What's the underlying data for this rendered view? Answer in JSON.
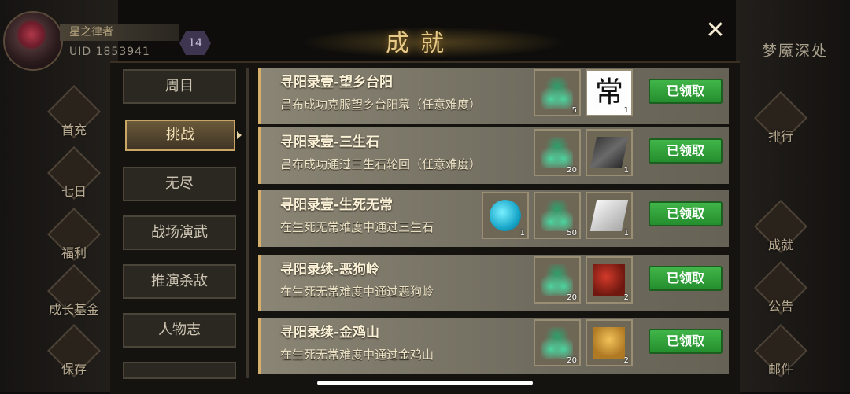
{
  "player": {
    "name": "星之律者",
    "uid": "UID  1853941",
    "level": "14"
  },
  "header": {
    "title": "成就",
    "close_glyph": "✕"
  },
  "right_panel": {
    "title": "梦魇深处",
    "icons": [
      "排行",
      "成就",
      "公告",
      "邮件"
    ]
  },
  "left_icons": [
    "首充",
    "七日",
    "福利",
    "成长基金",
    "保存"
  ],
  "nav": {
    "items": [
      "周目",
      "挑战",
      "无尽",
      "战场演武",
      "推演杀敌",
      "人物志"
    ],
    "active": "挑战"
  },
  "achievements": [
    {
      "title": "寻阳录壹-望乡台阳",
      "desc": "吕布成功克服望乡台阳幕（任意难度）",
      "rewards": [
        {
          "icon": "herb-icon",
          "count": "5"
        },
        {
          "icon": "char-chang-icon",
          "label": "常",
          "count": "1"
        }
      ],
      "status": "已领取"
    },
    {
      "title": "寻阳录壹-三生石",
      "desc": "吕布成功通过三生石轮回（任意难度）",
      "rewards": [
        {
          "icon": "herb-icon",
          "count": "20"
        },
        {
          "icon": "iron-cloth-icon",
          "count": "1"
        }
      ],
      "status": "已领取"
    },
    {
      "title": "寻阳录壹-生死无常",
      "desc": "在生死无常难度中通过三生石",
      "rewards": [
        {
          "icon": "gem-icon",
          "count": "1"
        },
        {
          "icon": "herb-icon",
          "count": "50"
        },
        {
          "icon": "white-cloth-icon",
          "count": "1"
        }
      ],
      "status": "已领取"
    },
    {
      "title": "寻阳录续-恶狗岭",
      "desc": "在生死无常难度中通过恶狗岭",
      "rewards": [
        {
          "icon": "herb-icon",
          "count": "20"
        },
        {
          "icon": "armor-icon",
          "count": "2"
        }
      ],
      "status": "已领取"
    },
    {
      "title": "寻阳录续-金鸡山",
      "desc": "在生死无常难度中通过金鸡山",
      "rewards": [
        {
          "icon": "herb-icon",
          "count": "20"
        },
        {
          "icon": "grain-icon",
          "count": "2"
        }
      ],
      "status": "已领取"
    }
  ]
}
